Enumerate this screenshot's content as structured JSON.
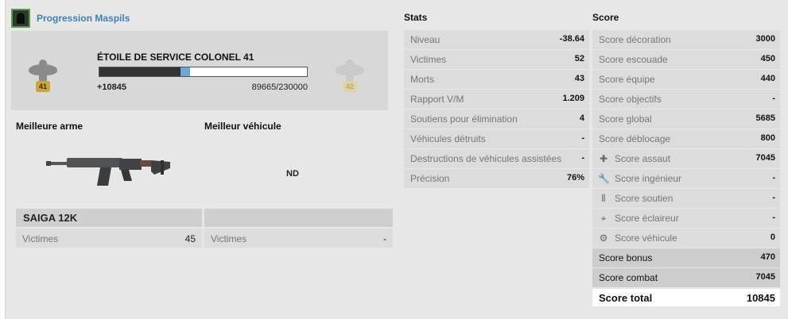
{
  "header": {
    "title": "Progression Maspils"
  },
  "rank": {
    "name": "ÉTOILE DE SERVICE COLONEL 41",
    "current_badge": "41",
    "next_badge": "42",
    "xp_gain": "+10845",
    "xp_progress": "89665/230000",
    "progress_fraction": 0.39,
    "gain_fraction": 0.047
  },
  "best_weapon": {
    "title": "Meilleure arme",
    "name": "SAIGA 12K",
    "kills_label": "Victimes",
    "kills_value": "45",
    "icon": "shotgun-icon"
  },
  "best_vehicle": {
    "title": "Meilleur véhicule",
    "name": "",
    "placeholder": "ND",
    "kills_label": "Victimes",
    "kills_value": "-"
  },
  "stats": {
    "title": "Stats",
    "rows": [
      {
        "label": "Niveau",
        "value": "-38.64"
      },
      {
        "label": "Victimes",
        "value": "52"
      },
      {
        "label": "Morts",
        "value": "43"
      },
      {
        "label": "Rapport V/M",
        "value": "1.209"
      },
      {
        "label": "Soutiens pour élimination",
        "value": "4"
      },
      {
        "label": "Véhicules détruits",
        "value": "-"
      },
      {
        "label": "Destructions de véhicules assistées",
        "value": "-"
      },
      {
        "label": "Précision",
        "value": "76%"
      }
    ]
  },
  "score": {
    "title": "Score",
    "rows": [
      {
        "label": "Score décoration",
        "value": "3000"
      },
      {
        "label": "Score escouade",
        "value": "450"
      },
      {
        "label": "Score équipe",
        "value": "440"
      },
      {
        "label": "Score objectifs",
        "value": "-"
      },
      {
        "label": "Score global",
        "value": "5685"
      },
      {
        "label": "Score déblocage",
        "value": "800"
      },
      {
        "label": "Score assaut",
        "value": "7045",
        "icon": "plus-icon"
      },
      {
        "label": "Score ingénieur",
        "value": "-",
        "icon": "wrench-icon"
      },
      {
        "label": "Score soutien",
        "value": "-",
        "icon": "ammo-icon"
      },
      {
        "label": "Score éclaireur",
        "value": "-",
        "icon": "crosshair-icon"
      },
      {
        "label": "Score véhicule",
        "value": "0",
        "icon": "gear-icon"
      },
      {
        "label": "Score bonus",
        "value": "470"
      },
      {
        "label": "Score combat",
        "value": "7045"
      },
      {
        "label": "Score total",
        "value": "10845"
      }
    ]
  }
}
